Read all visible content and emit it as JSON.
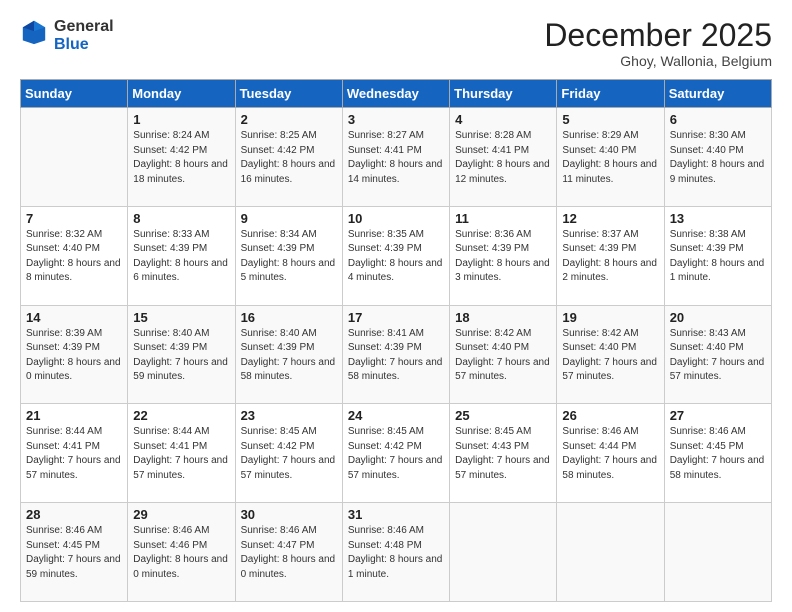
{
  "logo": {
    "general": "General",
    "blue": "Blue"
  },
  "header": {
    "month": "December 2025",
    "location": "Ghoy, Wallonia, Belgium"
  },
  "weekdays": [
    "Sunday",
    "Monday",
    "Tuesday",
    "Wednesday",
    "Thursday",
    "Friday",
    "Saturday"
  ],
  "weeks": [
    [
      {
        "date": "",
        "sunrise": "",
        "sunset": "",
        "daylight": ""
      },
      {
        "date": "1",
        "sunrise": "Sunrise: 8:24 AM",
        "sunset": "Sunset: 4:42 PM",
        "daylight": "Daylight: 8 hours and 18 minutes."
      },
      {
        "date": "2",
        "sunrise": "Sunrise: 8:25 AM",
        "sunset": "Sunset: 4:42 PM",
        "daylight": "Daylight: 8 hours and 16 minutes."
      },
      {
        "date": "3",
        "sunrise": "Sunrise: 8:27 AM",
        "sunset": "Sunset: 4:41 PM",
        "daylight": "Daylight: 8 hours and 14 minutes."
      },
      {
        "date": "4",
        "sunrise": "Sunrise: 8:28 AM",
        "sunset": "Sunset: 4:41 PM",
        "daylight": "Daylight: 8 hours and 12 minutes."
      },
      {
        "date": "5",
        "sunrise": "Sunrise: 8:29 AM",
        "sunset": "Sunset: 4:40 PM",
        "daylight": "Daylight: 8 hours and 11 minutes."
      },
      {
        "date": "6",
        "sunrise": "Sunrise: 8:30 AM",
        "sunset": "Sunset: 4:40 PM",
        "daylight": "Daylight: 8 hours and 9 minutes."
      }
    ],
    [
      {
        "date": "7",
        "sunrise": "Sunrise: 8:32 AM",
        "sunset": "Sunset: 4:40 PM",
        "daylight": "Daylight: 8 hours and 8 minutes."
      },
      {
        "date": "8",
        "sunrise": "Sunrise: 8:33 AM",
        "sunset": "Sunset: 4:39 PM",
        "daylight": "Daylight: 8 hours and 6 minutes."
      },
      {
        "date": "9",
        "sunrise": "Sunrise: 8:34 AM",
        "sunset": "Sunset: 4:39 PM",
        "daylight": "Daylight: 8 hours and 5 minutes."
      },
      {
        "date": "10",
        "sunrise": "Sunrise: 8:35 AM",
        "sunset": "Sunset: 4:39 PM",
        "daylight": "Daylight: 8 hours and 4 minutes."
      },
      {
        "date": "11",
        "sunrise": "Sunrise: 8:36 AM",
        "sunset": "Sunset: 4:39 PM",
        "daylight": "Daylight: 8 hours and 3 minutes."
      },
      {
        "date": "12",
        "sunrise": "Sunrise: 8:37 AM",
        "sunset": "Sunset: 4:39 PM",
        "daylight": "Daylight: 8 hours and 2 minutes."
      },
      {
        "date": "13",
        "sunrise": "Sunrise: 8:38 AM",
        "sunset": "Sunset: 4:39 PM",
        "daylight": "Daylight: 8 hours and 1 minute."
      }
    ],
    [
      {
        "date": "14",
        "sunrise": "Sunrise: 8:39 AM",
        "sunset": "Sunset: 4:39 PM",
        "daylight": "Daylight: 8 hours and 0 minutes."
      },
      {
        "date": "15",
        "sunrise": "Sunrise: 8:40 AM",
        "sunset": "Sunset: 4:39 PM",
        "daylight": "Daylight: 7 hours and 59 minutes."
      },
      {
        "date": "16",
        "sunrise": "Sunrise: 8:40 AM",
        "sunset": "Sunset: 4:39 PM",
        "daylight": "Daylight: 7 hours and 58 minutes."
      },
      {
        "date": "17",
        "sunrise": "Sunrise: 8:41 AM",
        "sunset": "Sunset: 4:39 PM",
        "daylight": "Daylight: 7 hours and 58 minutes."
      },
      {
        "date": "18",
        "sunrise": "Sunrise: 8:42 AM",
        "sunset": "Sunset: 4:40 PM",
        "daylight": "Daylight: 7 hours and 57 minutes."
      },
      {
        "date": "19",
        "sunrise": "Sunrise: 8:42 AM",
        "sunset": "Sunset: 4:40 PM",
        "daylight": "Daylight: 7 hours and 57 minutes."
      },
      {
        "date": "20",
        "sunrise": "Sunrise: 8:43 AM",
        "sunset": "Sunset: 4:40 PM",
        "daylight": "Daylight: 7 hours and 57 minutes."
      }
    ],
    [
      {
        "date": "21",
        "sunrise": "Sunrise: 8:44 AM",
        "sunset": "Sunset: 4:41 PM",
        "daylight": "Daylight: 7 hours and 57 minutes."
      },
      {
        "date": "22",
        "sunrise": "Sunrise: 8:44 AM",
        "sunset": "Sunset: 4:41 PM",
        "daylight": "Daylight: 7 hours and 57 minutes."
      },
      {
        "date": "23",
        "sunrise": "Sunrise: 8:45 AM",
        "sunset": "Sunset: 4:42 PM",
        "daylight": "Daylight: 7 hours and 57 minutes."
      },
      {
        "date": "24",
        "sunrise": "Sunrise: 8:45 AM",
        "sunset": "Sunset: 4:42 PM",
        "daylight": "Daylight: 7 hours and 57 minutes."
      },
      {
        "date": "25",
        "sunrise": "Sunrise: 8:45 AM",
        "sunset": "Sunset: 4:43 PM",
        "daylight": "Daylight: 7 hours and 57 minutes."
      },
      {
        "date": "26",
        "sunrise": "Sunrise: 8:46 AM",
        "sunset": "Sunset: 4:44 PM",
        "daylight": "Daylight: 7 hours and 58 minutes."
      },
      {
        "date": "27",
        "sunrise": "Sunrise: 8:46 AM",
        "sunset": "Sunset: 4:45 PM",
        "daylight": "Daylight: 7 hours and 58 minutes."
      }
    ],
    [
      {
        "date": "28",
        "sunrise": "Sunrise: 8:46 AM",
        "sunset": "Sunset: 4:45 PM",
        "daylight": "Daylight: 7 hours and 59 minutes."
      },
      {
        "date": "29",
        "sunrise": "Sunrise: 8:46 AM",
        "sunset": "Sunset: 4:46 PM",
        "daylight": "Daylight: 8 hours and 0 minutes."
      },
      {
        "date": "30",
        "sunrise": "Sunrise: 8:46 AM",
        "sunset": "Sunset: 4:47 PM",
        "daylight": "Daylight: 8 hours and 0 minutes."
      },
      {
        "date": "31",
        "sunrise": "Sunrise: 8:46 AM",
        "sunset": "Sunset: 4:48 PM",
        "daylight": "Daylight: 8 hours and 1 minute."
      },
      {
        "date": "",
        "sunrise": "",
        "sunset": "",
        "daylight": ""
      },
      {
        "date": "",
        "sunrise": "",
        "sunset": "",
        "daylight": ""
      },
      {
        "date": "",
        "sunrise": "",
        "sunset": "",
        "daylight": ""
      }
    ]
  ]
}
